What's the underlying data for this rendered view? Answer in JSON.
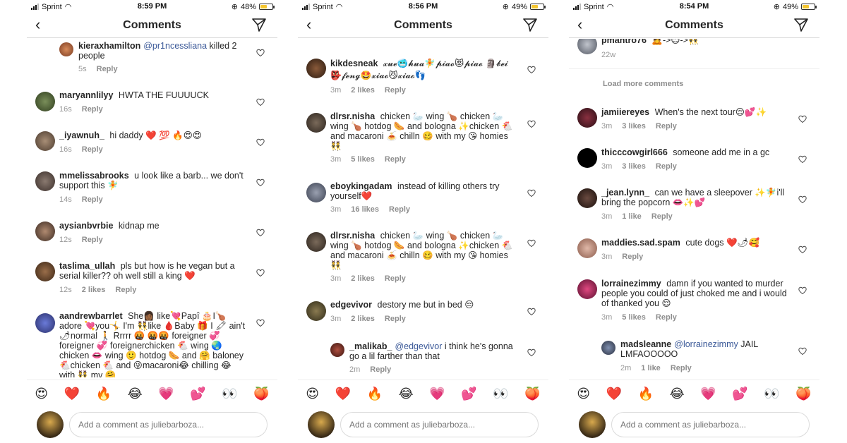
{
  "common": {
    "title": "Comments",
    "carrier": "Sprint",
    "placeholder": "Add a comment as juliebarboza...",
    "reply_label": "Reply",
    "emoji_bar": [
      "😍",
      "❤️",
      "🔥",
      "😂",
      "💗",
      "💕",
      "👀",
      "🍑"
    ]
  },
  "phones": [
    {
      "time": "8:59 PM",
      "battery": "48%",
      "battery_level": 0.48,
      "comments": [
        {
          "user": "kieraxhamilton",
          "mention": "@pr1ncessliana",
          "text": "killed 2 people",
          "time": "5s",
          "likes": ""
        },
        {
          "user": "maryannlilyy",
          "mention": "",
          "text": "HWTA THE FUUUUCK",
          "time": "16s",
          "likes": ""
        },
        {
          "user": "_iyawnuh_",
          "mention": "",
          "text": "hi daddy ❤️ 💯 🔥😍😍",
          "time": "16s",
          "likes": ""
        },
        {
          "user": "mmelissabrooks",
          "mention": "",
          "text": "u look like a barb... we don't support this 🧚",
          "time": "14s",
          "likes": ""
        },
        {
          "user": "aysianbvrbie",
          "mention": "",
          "text": "kidnap me",
          "time": "12s",
          "likes": ""
        },
        {
          "user": "taslima_ullah",
          "mention": "",
          "text": "pls but how is he vegan but a serial killer?? oh well still a king ❤️",
          "time": "12s",
          "likes": "2 likes"
        },
        {
          "user": "aandrewbarrlet",
          "mention": "",
          "text": "She👩🏾 like💘Papî 🎂I🍗 adore 💘you🤸 I'm 👯like 🩸Baby 🎁 I 🖍 ain't 🌶normal 🚶 Rrrrr 🤬 🤬🤬 foreigner 💞 foreigner 💞 foreignerchicken 🐔 wing 🌏 chicken 👄 wing 🙂 hotdog 🌭 and 🤗 baloney 🐔chicken 🐔 and 😜macaroni😂 chilling 😂 with 👯 my 🤗",
          "time": "",
          "likes": ""
        }
      ]
    },
    {
      "time": "8:56 PM",
      "battery": "49%",
      "battery_level": 0.49,
      "comments": [
        {
          "user": "kikdesneak",
          "mention": "",
          "text": "𝔁𝓾𝓮🥶𝓱𝓾𝓪🧚𝓹𝓲𝓪𝓸😻𝓹𝓲𝓪𝓸 🗿𝓫𝓮𝓲👺𝓯𝓮𝓷𝓰🤩𝔁𝓲𝓪𝓸😼𝔁𝓲𝓪𝓸👣",
          "time": "3m",
          "likes": "2 likes"
        },
        {
          "user": "dlrsr.nisha",
          "mention": "",
          "text": "chicken 🦢 wing 🍗 chicken 🦢 wing 🍗 hotdog 🌭 and bologna ✨chicken 🐔 and macaroni 🍝 chilln 🥴 with my 😘 homies 👯",
          "time": "3m",
          "likes": "5 likes"
        },
        {
          "user": "eboykingadam",
          "mention": "",
          "text": "instead of killing others try yourself❤️",
          "time": "3m",
          "likes": "16 likes"
        },
        {
          "user": "dlrsr.nisha",
          "mention": "",
          "text": "chicken 🦢 wing 🍗 chicken 🦢 wing 🍗 hotdog 🌭 and bologna ✨chicken 🐔 and macaroni 🍝 chilln 🥴 with my 😘 homies 👯",
          "time": "3m",
          "likes": "2 likes"
        },
        {
          "user": "edgevivor",
          "mention": "",
          "text": "destory me but in bed 😔",
          "time": "3m",
          "likes": "2 likes"
        },
        {
          "user": "_malikab_",
          "mention": "@edgevivor",
          "text": "i think he's gonna go a lil farther than that",
          "time": "2m",
          "likes": "",
          "reply": true
        }
      ]
    },
    {
      "time": "8:54 PM",
      "battery": "49%",
      "battery_level": 0.49,
      "load_more": "Load more comments",
      "comments": [
        {
          "user": "pmantro76",
          "mention": "",
          "text": "🙇->😊->👯",
          "time": "22w",
          "likes": "",
          "noreply": true
        },
        {
          "user": "jamiiereyes",
          "mention": "",
          "text": "When's the next tour😌💕✨",
          "time": "3m",
          "likes": "3 likes"
        },
        {
          "user": "thicccowgirl666",
          "mention": "",
          "text": "someone add me in a gc",
          "time": "3m",
          "likes": "3 likes"
        },
        {
          "user": "_jean.lynn_",
          "mention": "",
          "text": "can we have a sleepover ✨🧚i'll bring the popcorn 👄✨💕",
          "time": "3m",
          "likes": "1 like"
        },
        {
          "user": "maddies.sad.spam",
          "mention": "",
          "text": "cute dogs ❤️🌶🥰",
          "time": "3m",
          "likes": ""
        },
        {
          "user": "lorrainezimmy",
          "mention": "",
          "text": "damn if you wanted to murder people you could of just choked me and i would of thanked you 😌",
          "time": "3m",
          "likes": "5 likes"
        },
        {
          "user": "madsleanne",
          "mention": "@lorrainezimmy",
          "text": "JAIL LMFAOOOOO",
          "time": "2m",
          "likes": "1 like",
          "reply": true
        }
      ]
    }
  ]
}
